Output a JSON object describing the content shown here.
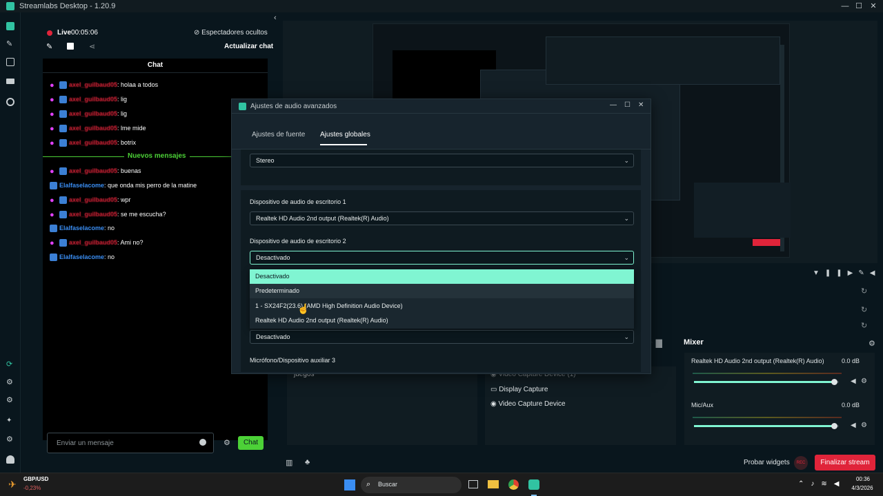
{
  "window": {
    "title": "Streamlabs Desktop - 1.20.9"
  },
  "chat_panel": {
    "live_label": "Live",
    "live_time": "00:05:06",
    "viewers_hidden": "Espectadores ocultos",
    "refresh_chat": "Actualizar chat",
    "chat_title": "Chat",
    "new_messages": "Nuevos mensajes",
    "input_placeholder": "Enviar un mensaje",
    "send_button": "Chat",
    "messages": [
      {
        "user": "axel_guilbaud05",
        "text": ": holaa a todos",
        "kind": "mic"
      },
      {
        "user": "axel_guilbaud05",
        "text": ": lig",
        "kind": "mic"
      },
      {
        "user": "axel_guilbaud05",
        "text": ": lig",
        "kind": "mic"
      },
      {
        "user": "axel_guilbaud05",
        "text": ": lme mide",
        "kind": "mic"
      },
      {
        "user": "axel_guilbaud05",
        "text": ": botrix",
        "kind": "mic"
      },
      {
        "user": "axel_guilbaud05",
        "text": ": buenas",
        "kind": "mic"
      },
      {
        "user": "Elalfaselacome",
        "text": ": que onda mis perro de la matine",
        "kind": "bot"
      },
      {
        "user": "axel_guilbaud05",
        "text": ": wpr",
        "kind": "mic"
      },
      {
        "user": "axel_guilbaud05",
        "text": ": se me escucha?",
        "kind": "mic"
      },
      {
        "user": "Elalfaselacome",
        "text": ": no",
        "kind": "bot"
      },
      {
        "user": "axel_guilbaud05",
        "text": ": Ami no?",
        "kind": "mic"
      },
      {
        "user": "Elalfaselacome",
        "text": ": no",
        "kind": "bot"
      }
    ]
  },
  "modal": {
    "title": "Ajustes de audio avanzados",
    "tabs": [
      "Ajustes de fuente",
      "Ajustes globales"
    ],
    "active_tab": "Ajustes globales",
    "channels_value": "Stereo",
    "desktop1_label": "Dispositivo de audio de escritorio 1",
    "desktop1_value": "Realtek HD Audio 2nd output (Realtek(R) Audio)",
    "desktop2_label": "Dispositivo de audio de escritorio 2",
    "desktop2_value": "Desactivado",
    "dropdown_options": [
      "Desactivado",
      "Predeterminado",
      "1 - SX24F2(23.6) (AMD High Definition Audio Device)",
      "Realtek HD Audio 2nd output (Realtek(R) Audio)"
    ],
    "hidden_field_value": "Desactivado",
    "mic3_label": "Micrófono/Dispositivo auxiliar 3"
  },
  "sources": {
    "scene_item": "juegos",
    "items": [
      "Video Capture Device (1)",
      "Display Capture",
      "Video Capture Device"
    ]
  },
  "mixer": {
    "title": "Mixer",
    "channels": [
      {
        "name": "Realtek HD Audio 2nd output (Realtek(R) Audio)",
        "db": "0.0 dB",
        "level": 0.97
      },
      {
        "name": "Mic/Aux",
        "db": "0.0 dB",
        "level": 0.97
      }
    ]
  },
  "footer": {
    "test_widgets": "Probar widgets",
    "rec": "REC",
    "end_stream": "Finalizar stream"
  },
  "taskbar": {
    "ticker_symbol": "GBP/USD",
    "ticker_change": "-0,23%",
    "search": "Buscar",
    "time": "00:36",
    "date": "4/3/2026"
  },
  "colors": {
    "accent": "#31c3a2",
    "mint": "#80f5d2",
    "live": "#e0243a",
    "end_stream": "#e0243a",
    "chat_green": "#4cd137"
  }
}
